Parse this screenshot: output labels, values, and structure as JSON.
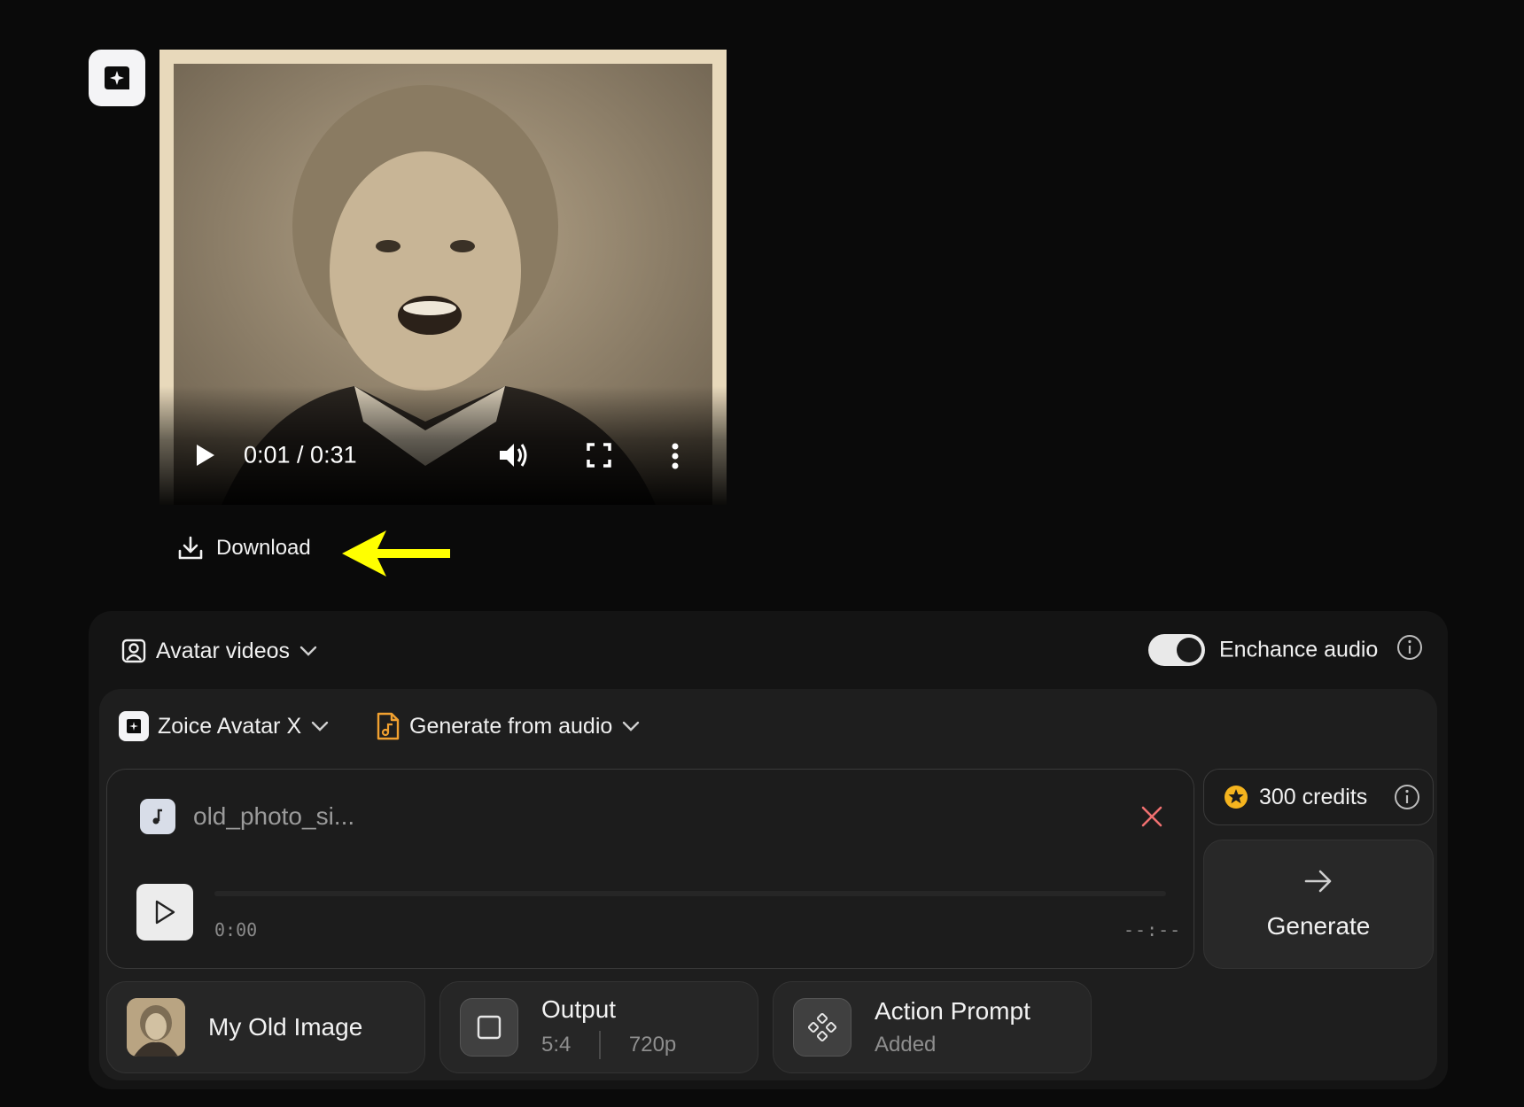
{
  "video": {
    "time_display": "0:01 / 0:31",
    "progress": 0.06
  },
  "download": {
    "label": "Download"
  },
  "annotation": {
    "arrow_color": "#ffff00"
  },
  "panel": {
    "mode": {
      "label": "Avatar videos"
    },
    "enhance_audio": {
      "label": "Enchance audio",
      "enabled": true
    },
    "model": {
      "label": "Zoice Avatar X"
    },
    "source": {
      "label": "Generate from audio",
      "icon_color": "#f0a030"
    },
    "audio": {
      "filename": "old_photo_si...",
      "time_current": "0:00",
      "time_total": "--:--"
    },
    "credits": {
      "label": "300 credits",
      "star_color": "#f5b41e"
    },
    "generate": {
      "label": "Generate"
    },
    "chips": {
      "image": {
        "label": "My Old Image"
      },
      "output": {
        "title": "Output",
        "ratio": "5:4",
        "resolution": "720p"
      },
      "action": {
        "title": "Action Prompt",
        "status": "Added"
      }
    }
  },
  "icons": {
    "app_logo": "sparkle-logo-icon",
    "play": "play-icon",
    "volume": "volume-icon",
    "fullscreen": "fullscreen-icon",
    "more": "more-vertical-icon",
    "download": "download-icon",
    "close": "close-icon",
    "arrow": "arrow-right-icon",
    "info": "info-icon"
  }
}
